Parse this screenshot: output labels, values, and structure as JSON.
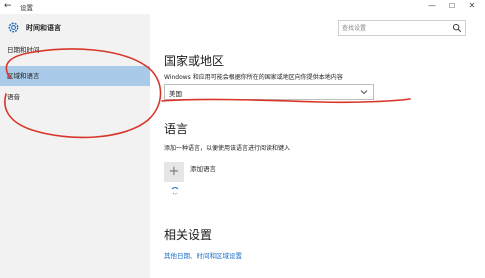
{
  "window": {
    "title": "设置",
    "min_glyph": "—",
    "max_glyph": "☐",
    "close_glyph": "✕",
    "back_glyph": "←"
  },
  "sidebar": {
    "header": "时间和语言",
    "items": [
      {
        "label": "日期和时间",
        "selected": false
      },
      {
        "label": "区域和语言",
        "selected": true
      },
      {
        "label": "语音",
        "selected": false
      }
    ]
  },
  "search": {
    "placeholder": "查找设置"
  },
  "region": {
    "title": "国家或地区",
    "description": "Windows 和应用可能会根据你所在的国家或地区向你提供本地内容",
    "selected_value": "美国"
  },
  "language": {
    "title": "语言",
    "description": "添加一种语言，以便使用该语言进行阅读和键入",
    "add_label": "添加语言"
  },
  "related": {
    "title": "相关设置",
    "link": "其他日期、时间和区域设置"
  },
  "colors": {
    "sidebar_bg": "#f2f2f2",
    "selected_bg": "#a9cbe9",
    "link": "#1b6fc8",
    "annotation": "#d9362b"
  },
  "icons": [
    "gear-icon",
    "search-icon",
    "chevron-down-icon",
    "plus-icon",
    "back-arrow-icon"
  ]
}
